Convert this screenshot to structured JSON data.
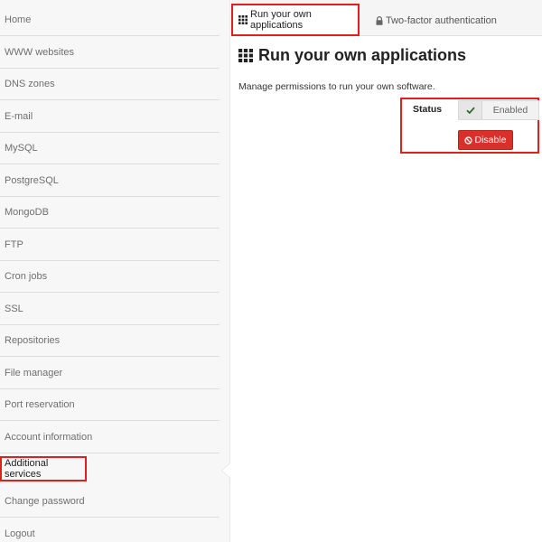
{
  "sidebar": {
    "items": [
      {
        "label": "Home"
      },
      {
        "label": "WWW websites"
      },
      {
        "label": "DNS zones"
      },
      {
        "label": "E-mail"
      },
      {
        "label": "MySQL"
      },
      {
        "label": "PostgreSQL"
      },
      {
        "label": "MongoDB"
      },
      {
        "label": "FTP"
      },
      {
        "label": "Cron jobs"
      },
      {
        "label": "SSL"
      },
      {
        "label": "Repositories"
      },
      {
        "label": "File manager"
      },
      {
        "label": "Port reservation"
      },
      {
        "label": "Account information"
      },
      {
        "label": "Additional services"
      },
      {
        "label": "Change password"
      },
      {
        "label": "Logout"
      }
    ],
    "active_index": 14
  },
  "tabs": [
    {
      "label": "Run your own applications",
      "icon": "grid-icon",
      "active": true
    },
    {
      "label": "Two-factor authentication",
      "icon": "lock-icon",
      "active": false
    }
  ],
  "main": {
    "title": "Run your own applications",
    "title_icon": "grid-icon",
    "description": "Manage permissions to run your own software.",
    "status_label": "Status",
    "status_value": "Enabled",
    "disable_button": "Disable"
  },
  "colors": {
    "highlight_red": "#e0201b",
    "danger_button": "#d9302b",
    "sidebar_bg": "#f7f7f7"
  }
}
